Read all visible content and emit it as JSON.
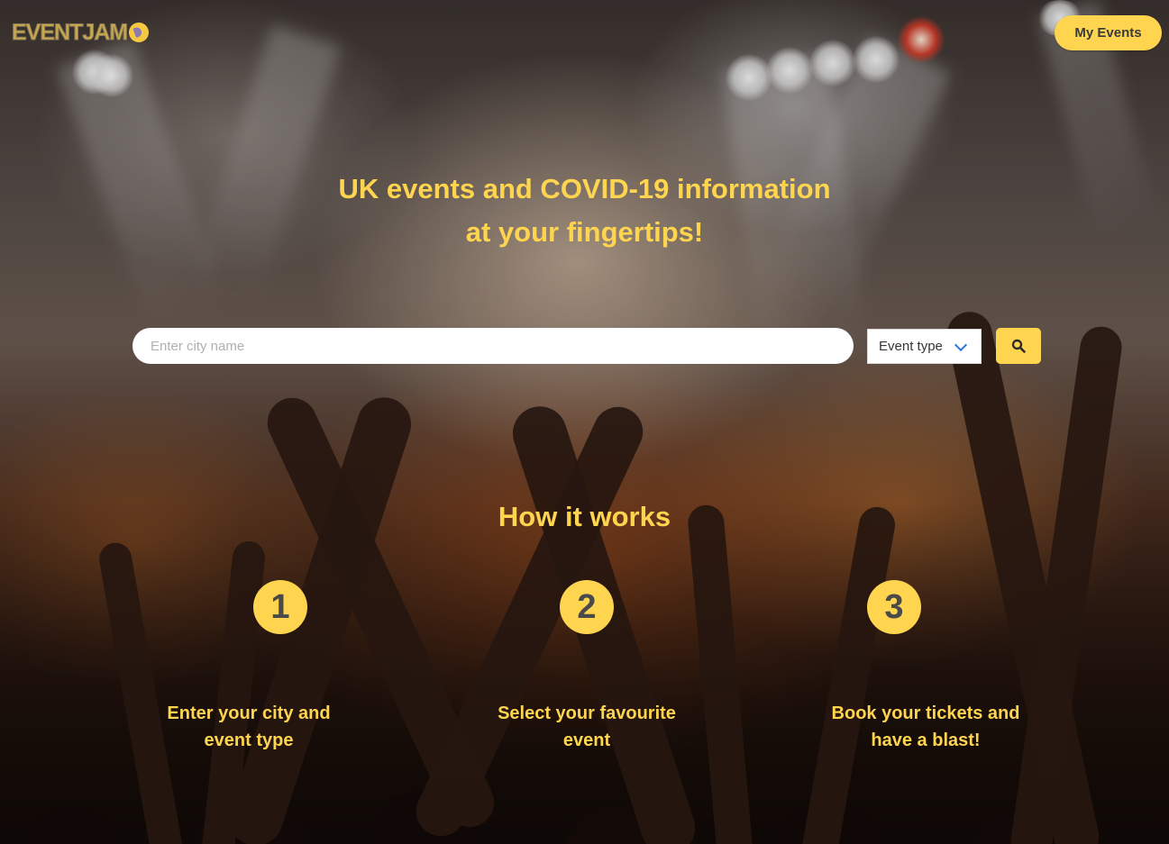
{
  "header": {
    "logo_text": "EVENTJAM",
    "logo_icon": "megaphone-icon",
    "my_events_label": "My Events"
  },
  "hero": {
    "title_line1": "UK events and COVID-19 information",
    "title_line2": "at your fingertips!"
  },
  "search": {
    "city_placeholder": "Enter city name",
    "event_type_selected": "Event type",
    "search_icon": "search-icon"
  },
  "how_it_works": {
    "title": "How it works",
    "steps": [
      {
        "number": "1",
        "line1": "Enter your city and",
        "line2": "event type"
      },
      {
        "number": "2",
        "line1": "Select your favourite",
        "line2": "event"
      },
      {
        "number": "3",
        "line1": "Book your tickets and",
        "line2": "have a blast!"
      }
    ]
  },
  "colors": {
    "accent": "#ffd54f",
    "button_text": "#3a3a3a",
    "select_chevron": "#3273dc"
  }
}
